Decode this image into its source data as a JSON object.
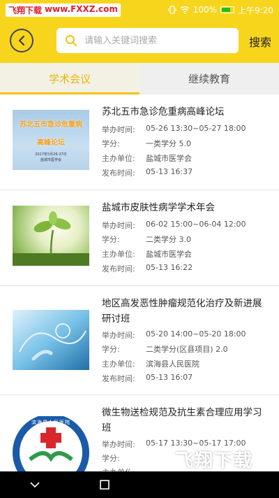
{
  "statusbar": {
    "site_name": "飞翔下载",
    "site_url": "www.FXXZ.com",
    "battery": "100%",
    "time": "上午9:20"
  },
  "header": {
    "search_placeholder": "请输入关键词搜索",
    "search_button": "搜索"
  },
  "tabs": [
    {
      "label": "学术会议",
      "active": true
    },
    {
      "label": "继续教育",
      "active": false
    }
  ],
  "labels": {
    "time": "举办时间:",
    "credit": "学分:",
    "host": "主办单位:",
    "published": "发布时间:"
  },
  "items": [
    {
      "title": "苏北五市急诊危重病高峰论坛",
      "time": "05-26 13:30~05-27 18:00",
      "credit": "一类学分 5.0",
      "host": "盐城市医学会",
      "published": "05-13 16:37",
      "thumb_line1": "苏北五市急诊危重病",
      "thumb_line2": "高峰论坛",
      "thumb_small1": "2017年5月26-27日",
      "thumb_small2": "盐城市医学会"
    },
    {
      "title": "盐城市皮肤性病学学术年会",
      "time": "06-02 15:00~06-04 12:00",
      "credit": "二类学分 3.0",
      "host": "盐城市医学会",
      "published": "05-13 16:22"
    },
    {
      "title": "地区高发恶性肿瘤规范化治疗及新进展研讨班",
      "time": "05-20 14:00~05-20 18:00",
      "credit": "二类学分(区县项目) 2.0",
      "host": "滨海县人民医院",
      "published": "05-13 16:07"
    },
    {
      "title": "微生物送检规范及抗生素合理应用学习班",
      "time": "05-17 13:30~05-17 17:00",
      "host": "",
      "thumb_ring_text": "滨海县人民医院"
    }
  ],
  "watermark": {
    "brand": "飞翔下载",
    "url": "www.fxxz.com"
  }
}
